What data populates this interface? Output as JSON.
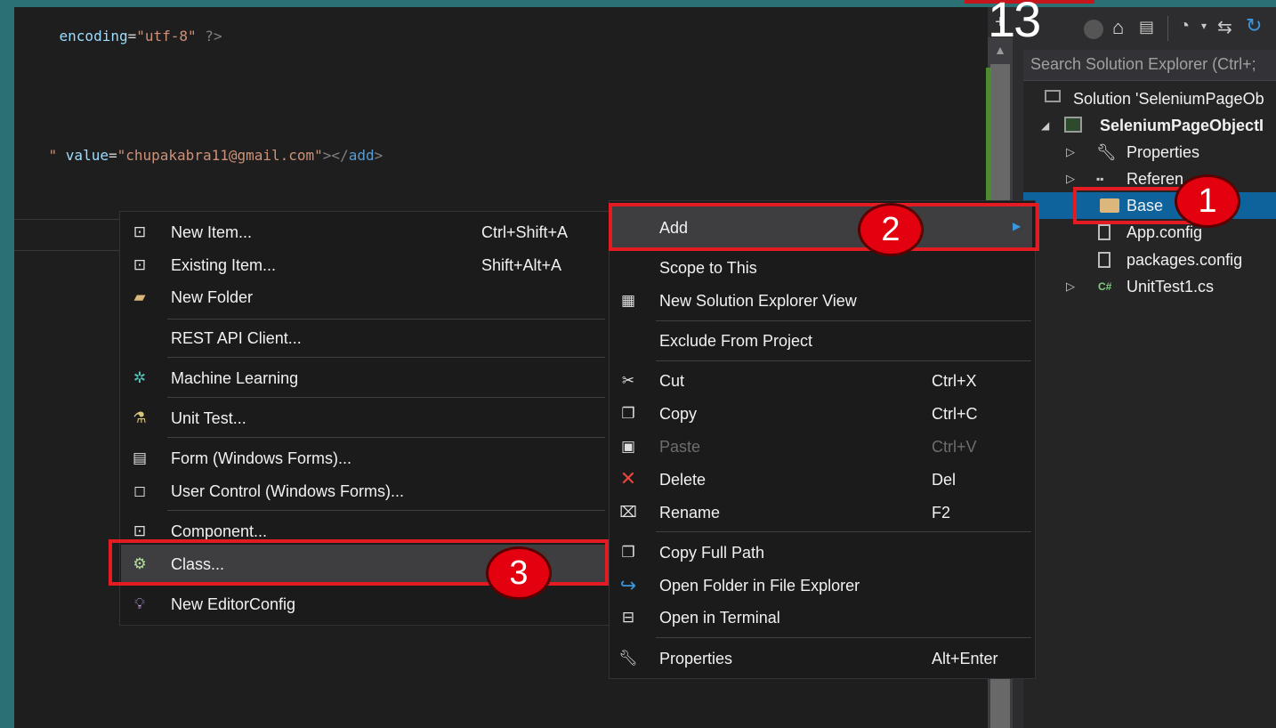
{
  "editor": {
    "line1": {
      "attr": "encoding",
      "eq": "=",
      "val": "\"utf-8\"",
      "end": " ?>"
    },
    "line2": {
      "pre": "\" ",
      "attr": "value",
      "eq": "=",
      "val": "\"chupakabra11@gmail.com\"",
      "close1": "></",
      "tag": "add",
      "close2": ">"
    }
  },
  "step_counter": "13",
  "solution_explorer": {
    "search_placeholder": "Search Solution Explorer (Ctrl+;",
    "tree": [
      {
        "label": "Solution 'SeleniumPageOb",
        "icon": "solution-icon"
      },
      {
        "label": "SeleniumPageObjectI",
        "icon": "test-project-icon"
      },
      {
        "label": "Properties",
        "icon": "wrench-icon"
      },
      {
        "label": "Referen",
        "icon": "references-icon"
      },
      {
        "label": "Base",
        "icon": "folder-icon"
      },
      {
        "label": "App.config",
        "icon": "config-file-icon"
      },
      {
        "label": "packages.config",
        "icon": "config-file-icon"
      },
      {
        "label": "UnitTest1.cs",
        "icon": "csharp-file-icon"
      }
    ]
  },
  "add_submenu": {
    "items": [
      {
        "label": "New Item...",
        "shortcut": "Ctrl+Shift+A",
        "icon": "new-item-icon"
      },
      {
        "label": "Existing Item...",
        "shortcut": "Shift+Alt+A",
        "icon": "existing-item-icon"
      },
      {
        "label": "New Folder",
        "shortcut": "",
        "icon": "new-folder-icon"
      },
      {
        "label": "REST API Client...",
        "shortcut": "",
        "icon": ""
      },
      {
        "label": "Machine Learning",
        "shortcut": "",
        "icon": "machine-learning-icon"
      },
      {
        "label": "Unit Test...",
        "shortcut": "",
        "icon": "unit-test-icon"
      },
      {
        "label": "Form (Windows Forms)...",
        "shortcut": "",
        "icon": "form-icon"
      },
      {
        "label": "User Control (Windows Forms)...",
        "shortcut": "",
        "icon": "user-control-icon"
      },
      {
        "label": "Component...",
        "shortcut": "",
        "icon": "component-icon"
      },
      {
        "label": "Class...",
        "shortcut": "",
        "icon": "class-icon"
      },
      {
        "label": "New EditorConfig",
        "shortcut": "",
        "icon": "editorconfig-icon"
      }
    ]
  },
  "context_menu": {
    "items": [
      {
        "label": "Add",
        "shortcut": "",
        "icon": ""
      },
      {
        "label": "Scope to This",
        "shortcut": "",
        "icon": ""
      },
      {
        "label": "New Solution Explorer View",
        "shortcut": "",
        "icon": "new-view-icon"
      },
      {
        "label": "Exclude From Project",
        "shortcut": "",
        "icon": ""
      },
      {
        "label": "Cut",
        "shortcut": "Ctrl+X",
        "icon": "scissors-icon"
      },
      {
        "label": "Copy",
        "shortcut": "Ctrl+C",
        "icon": "copy-icon"
      },
      {
        "label": "Paste",
        "shortcut": "Ctrl+V",
        "icon": "paste-icon",
        "disabled": true
      },
      {
        "label": "Delete",
        "shortcut": "Del",
        "icon": "delete-icon"
      },
      {
        "label": "Rename",
        "shortcut": "F2",
        "icon": "rename-icon"
      },
      {
        "label": "Copy Full Path",
        "shortcut": "",
        "icon": "copy-path-icon"
      },
      {
        "label": "Open Folder in File Explorer",
        "shortcut": "",
        "icon": "open-folder-icon"
      },
      {
        "label": "Open in Terminal",
        "shortcut": "",
        "icon": "terminal-icon"
      },
      {
        "label": "Properties",
        "shortcut": "Alt+Enter",
        "icon": "wrench-icon"
      }
    ]
  },
  "callouts": [
    "1",
    "2",
    "3"
  ],
  "colors": {
    "highlight": "#e51b24",
    "selection": "#0e639c",
    "badge": "#e3000f"
  }
}
